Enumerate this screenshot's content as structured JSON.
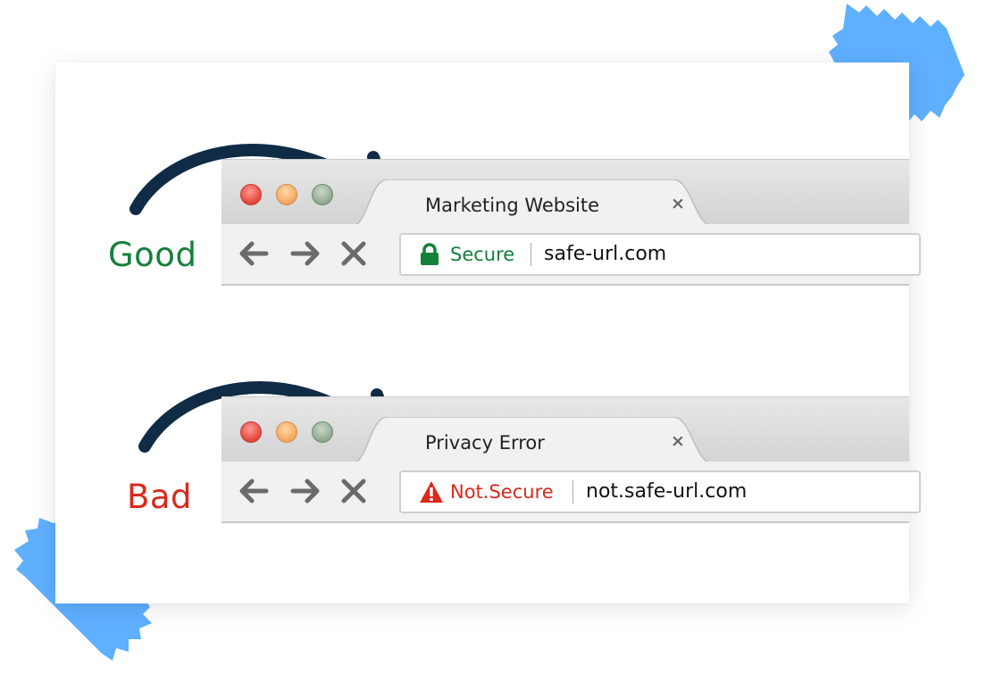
{
  "colors": {
    "good": "#15803a",
    "bad": "#d9291c",
    "arrow": "#0f2b45",
    "tape": "#5fb0ff"
  },
  "good": {
    "label": "Good",
    "tab_title": "Marketing Website",
    "tab_close": "×",
    "security_text": "Secure",
    "security_icon": "lock-icon",
    "url": "safe-url.com"
  },
  "bad": {
    "label": "Bad",
    "tab_title": "Privacy Error",
    "tab_close": "×",
    "security_text": "Not.Secure",
    "security_icon": "warning-icon",
    "url": "not.safe-url.com"
  }
}
